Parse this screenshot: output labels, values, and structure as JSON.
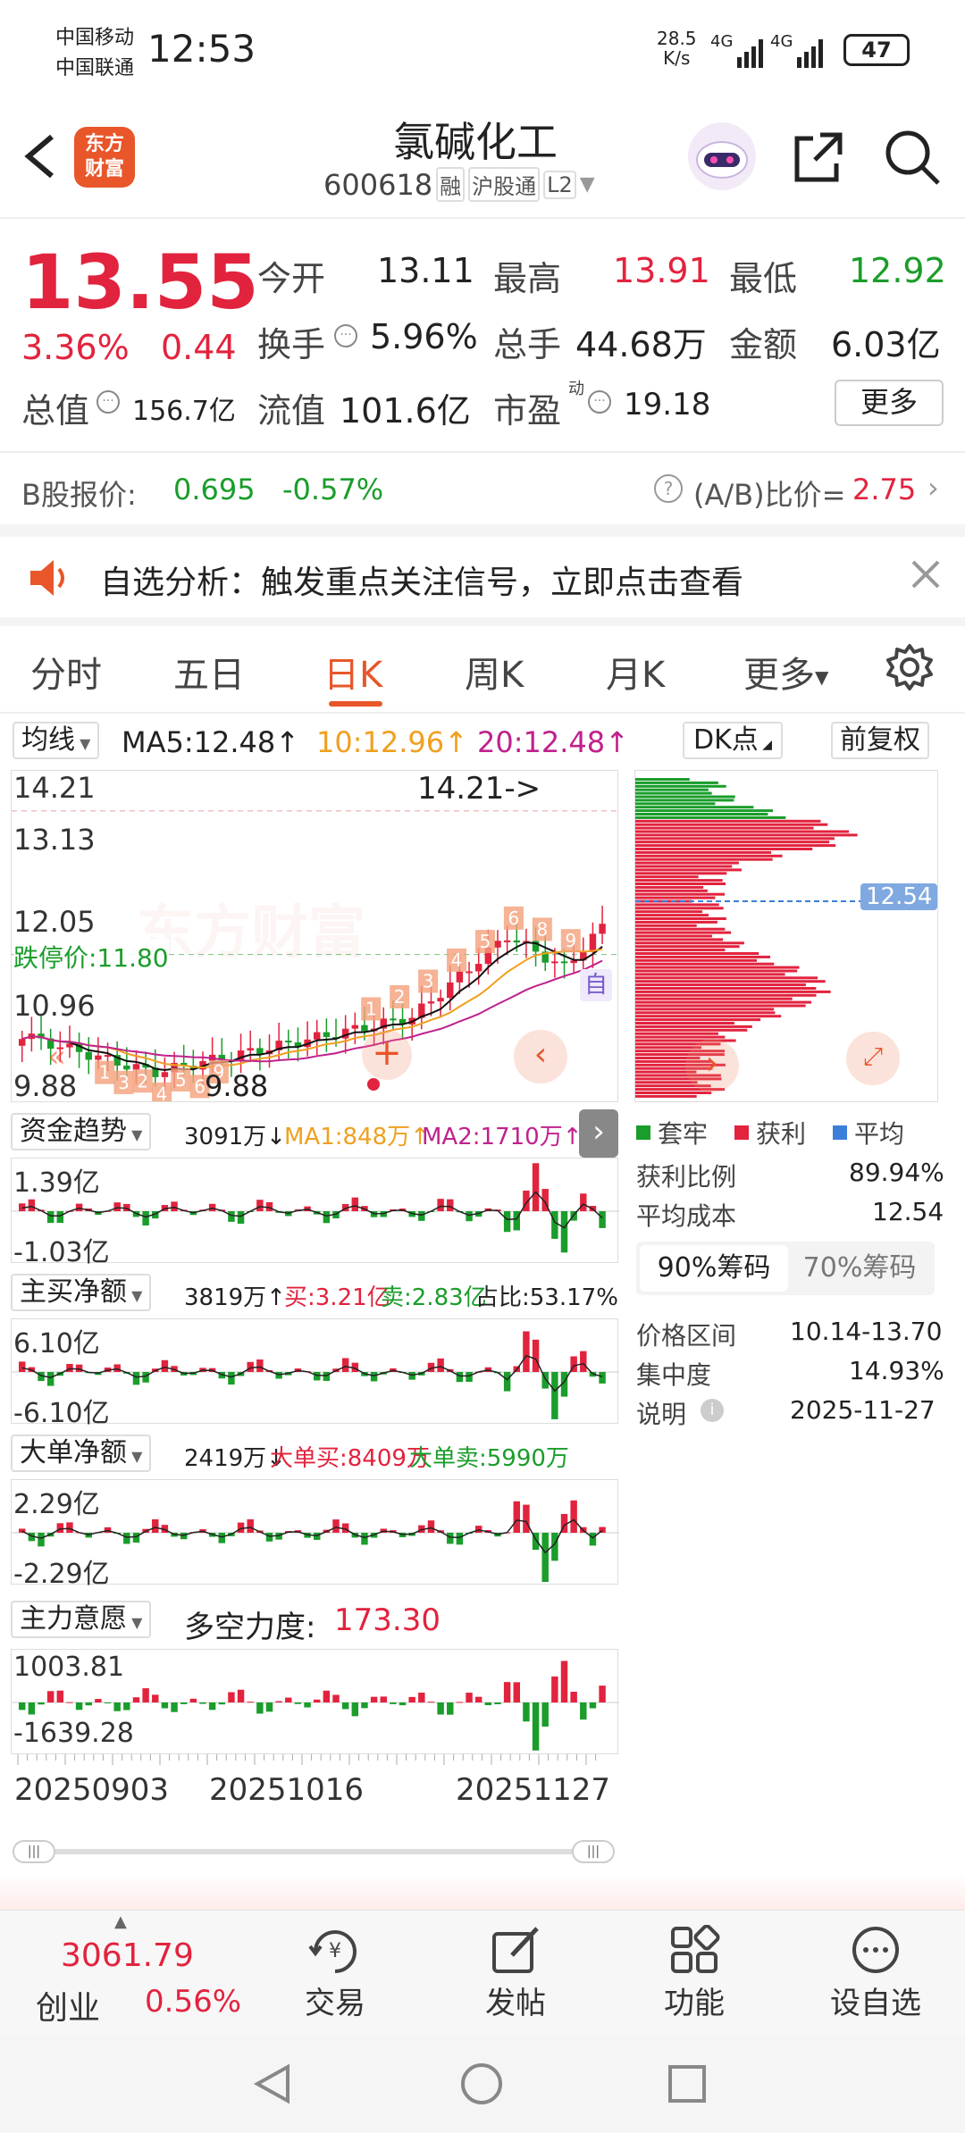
{
  "status": {
    "carrier1": "中国移动",
    "carrier2": "中国联通",
    "time": "12:53",
    "net_speed_value": "28.5",
    "net_speed_unit": "K/s",
    "sig1": "4G",
    "sig2": "4G",
    "battery": "47"
  },
  "header": {
    "logo_line1": "东方",
    "logo_line2": "财富",
    "stock_name": "氯碱化工",
    "stock_code": "600618",
    "tag1": "融",
    "tag2": "沪股通",
    "tag3": "L2"
  },
  "quote": {
    "price": "13.55",
    "change_pct": "3.36%",
    "change": "0.44",
    "open_label": "今开",
    "open": "13.11",
    "high_label": "最高",
    "high": "13.91",
    "low_label": "最低",
    "low": "12.92",
    "turnover_label": "换手",
    "turnover": "5.96%",
    "volume_label": "总手",
    "volume": "44.68万",
    "amount_label": "金额",
    "amount": "6.03亿",
    "mktcap_label": "总值",
    "mktcap": "156.7亿",
    "float_label": "流值",
    "float": "101.6亿",
    "pe_label": "市盈",
    "pe_sup": "动",
    "pe": "19.18",
    "more_btn": "更多"
  },
  "bshare": {
    "label": "B股报价:",
    "price": "0.695",
    "pct": "-0.57%",
    "ratio_label": "(A/B)比价=",
    "ratio": "2.75"
  },
  "notice": {
    "text": "自选分析：触发重点关注信号，立即点击查看"
  },
  "tabs": [
    "分时",
    "五日",
    "日K",
    "周K",
    "月K",
    "更多"
  ],
  "active_tab": 2,
  "ma_bar": {
    "mode": "均线",
    "ma5": "MA5:12.48↑",
    "ma10": "10:12.96↑",
    "ma20": "20:12.48↑",
    "dk": "DK点",
    "adjust": "前复权"
  },
  "kline": {
    "top_price": "14.21",
    "mid1": "13.13",
    "mid2": "12.05",
    "mid3": "10.96",
    "bottom_price": "9.88",
    "limit_down": "跌停价:11.80",
    "high_marker": "14.21->",
    "low_marker": "9.88",
    "self_tag": "自",
    "watermark": "东方财富",
    "nine_mark": "9",
    "dk_marks": [
      "1",
      "3",
      "2",
      "4",
      "5",
      "6",
      "9",
      "1",
      "2",
      "3",
      "4",
      "5",
      "6",
      "8",
      "9"
    ]
  },
  "chips": {
    "avg_price_tag": "12.54",
    "legend_trapped": "套牢",
    "legend_profit": "获利",
    "legend_avg": "平均",
    "profit_ratio_label": "获利比例",
    "profit_ratio": "89.94%",
    "avg_cost_label": "平均成本",
    "avg_cost": "12.54",
    "tab90": "90%筹码",
    "tab70": "70%筹码",
    "range_label": "价格区间",
    "range": "10.14-13.70",
    "concentration_label": "集中度",
    "concentration": "14.93%",
    "note_label": "说明",
    "note_date": "2025-11-27"
  },
  "panels": {
    "fund": {
      "name": "资金趋势",
      "v": "3091万↓",
      "ma1": "MA1:848万↑",
      "ma2": "MA2:1710万↑",
      "top": "1.39亿",
      "bottom": "-1.03亿"
    },
    "mainnet": {
      "name": "主买净额",
      "v": "3819万↑",
      "buy": "买:3.21亿",
      "sell": "卖:2.83亿",
      "ratio": "占比:53.17%",
      "top": "6.10亿",
      "bottom": "-6.10亿"
    },
    "bignet": {
      "name": "大单净额",
      "v": "2419万↓",
      "buy": "大单买:8409万",
      "sell": "大单卖:5990万",
      "top": "2.29亿",
      "bottom": "-2.29亿"
    },
    "intent": {
      "name": "主力意愿",
      "label": "多空力度:",
      "value": "173.30",
      "top": "1003.81",
      "bottom": "-1639.28"
    }
  },
  "dates": [
    "20250903",
    "20251016",
    "20251127"
  ],
  "bottom_bar": {
    "index_value": "3061.79",
    "index_name": "创业",
    "index_pct": "0.56%",
    "trade": "交易",
    "post": "发帖",
    "func": "功能",
    "watch": "设自选"
  },
  "colors": {
    "up": "#e2233e",
    "down": "#1a9d2b",
    "accent": "#e8562a",
    "ma10": "#f0a020",
    "ma20": "#c0218c"
  }
}
